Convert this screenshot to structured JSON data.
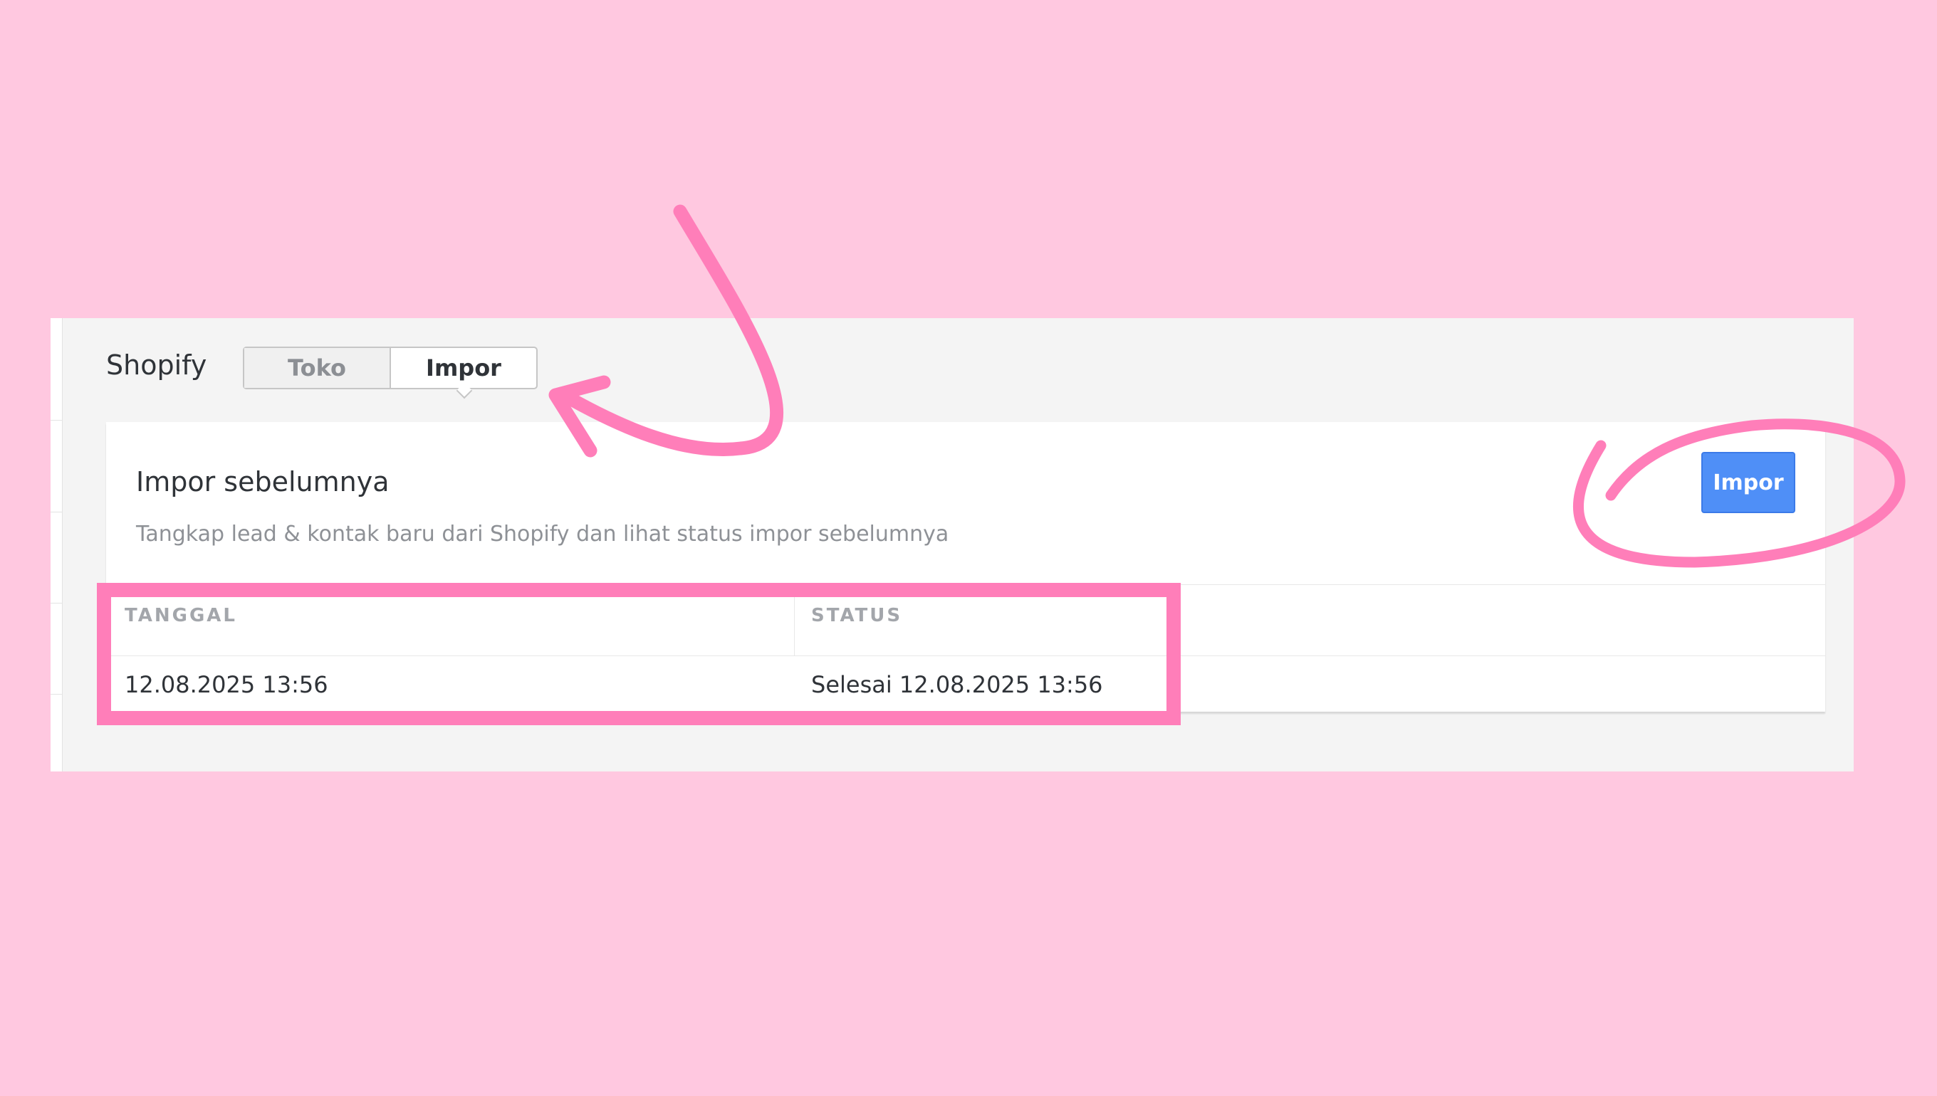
{
  "header": {
    "title": "Shopify",
    "tabs": [
      {
        "label": "Toko",
        "active": false
      },
      {
        "label": "Impor",
        "active": true
      }
    ]
  },
  "card": {
    "title": "Impor sebelumnya",
    "description": "Tangkap lead & kontak baru dari Shopify dan lihat status impor sebelumnya",
    "import_button_label": "Impor"
  },
  "table": {
    "columns": [
      "TANGGAL",
      "STATUS"
    ],
    "rows": [
      {
        "date": "12.08.2025 13:56",
        "status": "Selesai 12.08.2025 13:56"
      }
    ]
  },
  "annotations": {
    "color": "#ff7eb9",
    "arrow_target": "tab-impor",
    "circle_target": "import-button",
    "box_target": "import-history-table"
  },
  "colors": {
    "background": "#ffc8e0",
    "accent_button": "#4f8ff7",
    "panel": "#f4f4f4"
  }
}
